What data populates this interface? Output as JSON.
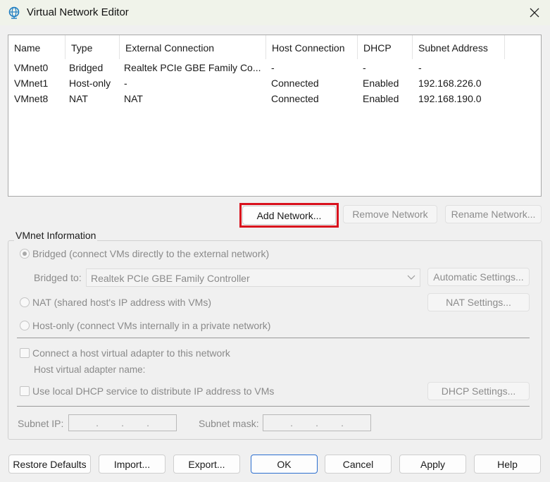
{
  "window": {
    "title": "Virtual Network Editor"
  },
  "table": {
    "columns": [
      "Name",
      "Type",
      "External Connection",
      "Host Connection",
      "DHCP",
      "Subnet Address"
    ],
    "rows": [
      [
        "VMnet0",
        "Bridged",
        "Realtek PCIe GBE Family Co...",
        "-",
        "-",
        "-"
      ],
      [
        "VMnet1",
        "Host-only",
        "-",
        "Connected",
        "Enabled",
        "192.168.226.0"
      ],
      [
        "VMnet8",
        "NAT",
        "NAT",
        "Connected",
        "Enabled",
        "192.168.190.0"
      ]
    ]
  },
  "network_buttons": {
    "add": "Add Network...",
    "remove": "Remove Network",
    "rename": "Rename Network..."
  },
  "vmnet_info": {
    "title": "VMnet Information",
    "bridged_label": "Bridged (connect VMs directly to the external network)",
    "bridged_to_label": "Bridged to:",
    "bridged_to_value": "Realtek PCIe GBE Family Controller",
    "automatic_settings": "Automatic Settings...",
    "nat_label": "NAT (shared host's IP address with VMs)",
    "nat_settings": "NAT Settings...",
    "hostonly_label": "Host-only (connect VMs internally in a private network)",
    "connect_adapter_label": "Connect a host virtual adapter to this network",
    "adapter_name_label": "Host virtual adapter name:",
    "dhcp_label": "Use local DHCP service to distribute IP address to VMs",
    "dhcp_settings": "DHCP Settings...",
    "subnet_ip_label": "Subnet IP:",
    "subnet_mask_label": "Subnet mask:"
  },
  "footer": {
    "restore": "Restore Defaults",
    "import": "Import...",
    "export": "Export...",
    "ok": "OK",
    "cancel": "Cancel",
    "apply": "Apply",
    "help": "Help"
  }
}
